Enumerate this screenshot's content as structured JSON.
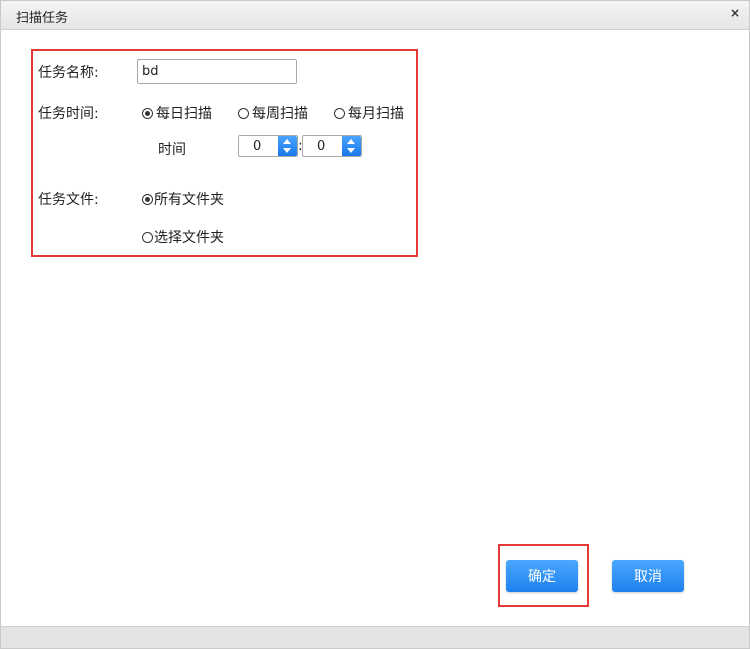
{
  "dialog": {
    "title": "扫描任务",
    "close_glyph": "×"
  },
  "form": {
    "task_name_label": "任务名称:",
    "task_name_value": "bd",
    "task_time_label": "任务时间:",
    "schedule_options": [
      {
        "label": "每日扫描",
        "checked": true
      },
      {
        "label": "每周扫描",
        "checked": false
      },
      {
        "label": "每月扫描",
        "checked": false
      }
    ],
    "time_label": "时间",
    "hour_value": "0",
    "minute_value": "0",
    "time_separator": ":",
    "task_file_label": "任务文件:",
    "file_options": [
      {
        "label": "所有文件夹",
        "checked": true
      },
      {
        "label": "选择文件夹",
        "checked": false
      }
    ]
  },
  "buttons": {
    "ok": "确定",
    "cancel": "取消"
  },
  "colors": {
    "highlight": "#e53935",
    "button": "#1d80ee"
  }
}
